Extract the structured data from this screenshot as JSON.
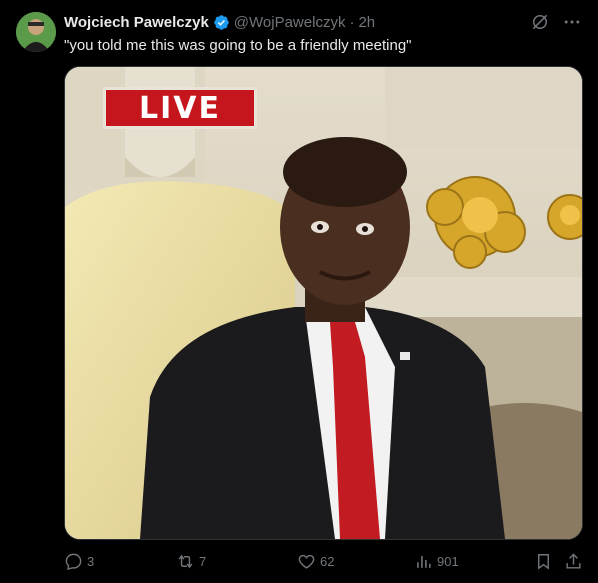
{
  "tweet": {
    "display_name": "Wojciech Pawelczyk",
    "handle": "@WojPawelczyk",
    "separator": "·",
    "time": "2h",
    "text": "\"you told me this was going to be a friendly meeting\"",
    "media_overlay": "LIVE"
  },
  "actions": {
    "replies": "3",
    "reposts": "7",
    "likes": "62",
    "views": "901"
  },
  "icons": {
    "verified": "verified-badge-icon",
    "grok": "grok-icon",
    "more": "more-icon",
    "reply": "reply-icon",
    "repost": "repost-icon",
    "like": "heart-icon",
    "views": "views-chart-icon",
    "bookmark": "bookmark-icon",
    "share": "share-icon"
  },
  "colors": {
    "background": "#000000",
    "text": "#e7e9ea",
    "muted": "#71767b",
    "verified": "#1d9bf0",
    "live_red": "#c4161c"
  }
}
